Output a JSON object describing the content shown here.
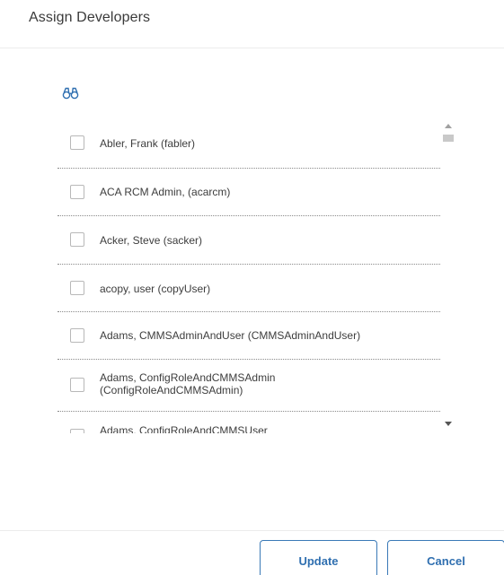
{
  "dialog": {
    "title": "Assign Developers"
  },
  "search": {
    "icon": "binoculars-icon",
    "color": "#2f6fb0"
  },
  "list": {
    "items": [
      {
        "label": "Abler, Frank (fabler)",
        "checked": false
      },
      {
        "label": "ACA RCM Admin, (acarcm)",
        "checked": false
      },
      {
        "label": "Acker, Steve (sacker)",
        "checked": false
      },
      {
        "label": "acopy, user (copyUser)",
        "checked": false
      },
      {
        "label": "Adams, CMMSAdminAndUser (CMMSAdminAndUser)",
        "checked": false
      },
      {
        "label": "Adams, ConfigRoleAndCMMSAdmin (ConfigRoleAndCMMSAdmin)",
        "checked": false
      },
      {
        "label": "Adams, ConfigRoleAndCMMSUser",
        "checked": false
      }
    ]
  },
  "footer": {
    "update_label": "Update",
    "cancel_label": "Cancel"
  },
  "colors": {
    "accent": "#2f6fb0",
    "text": "#3d3d3d",
    "divider": "#8a8a8a"
  }
}
